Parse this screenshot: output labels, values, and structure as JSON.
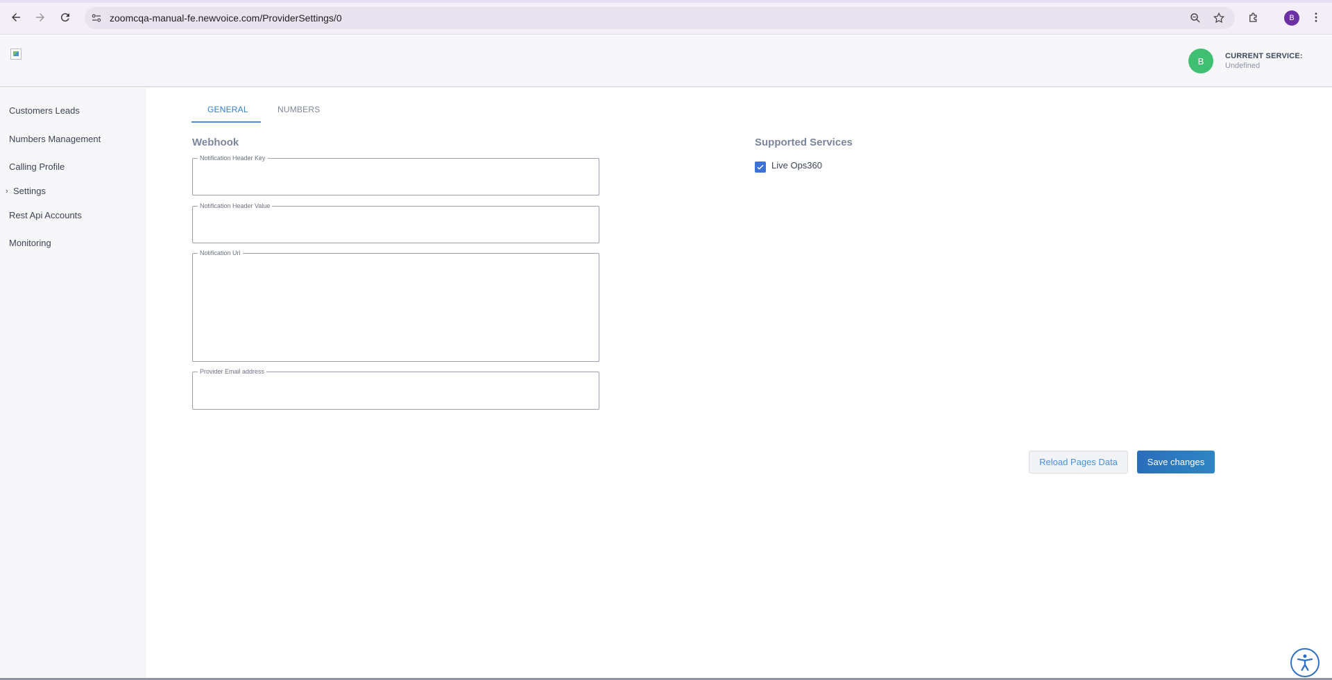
{
  "browser": {
    "url": "zoomcqa-manual-fe.newvoice.com/ProviderSettings/0",
    "profile_initial": "B",
    "icons": [
      "back-icon",
      "forward-icon",
      "reload-icon",
      "site-info-icon",
      "zoom-icon",
      "star-icon",
      "extensions-icon",
      "menu-icon"
    ]
  },
  "header": {
    "user_initial": "B",
    "current_service_label": "CURRENT SERVICE:",
    "current_service_value": "Undefined"
  },
  "sidebar": {
    "items": [
      {
        "label": "Customers Leads"
      },
      {
        "label": "Numbers Management"
      },
      {
        "label": "Calling Profile"
      },
      {
        "label": "Settings"
      },
      {
        "label": "Rest Api Accounts"
      },
      {
        "label": "Monitoring"
      }
    ]
  },
  "tabs": [
    {
      "label": "GENERAL",
      "active": true
    },
    {
      "label": "NUMBERS",
      "active": false
    }
  ],
  "webhook": {
    "title": "Webhook",
    "fields": [
      {
        "label": "Notification Header Key",
        "value": ""
      },
      {
        "label": "Notification Header Value",
        "value": ""
      },
      {
        "label": "Notification Url",
        "value": ""
      },
      {
        "label": "Provider Email address",
        "value": ""
      }
    ]
  },
  "supported_services": {
    "title": "Supported Services",
    "items": [
      {
        "label": "Live Ops360",
        "checked": true
      }
    ]
  },
  "actions": {
    "reload_label": "Reload Pages Data",
    "save_label": "Save changes"
  },
  "colors": {
    "accent": "#2f7fc9",
    "save_button": "#2a6dbb",
    "user_avatar": "#3fbf72",
    "checkbox": "#3f72d6"
  }
}
